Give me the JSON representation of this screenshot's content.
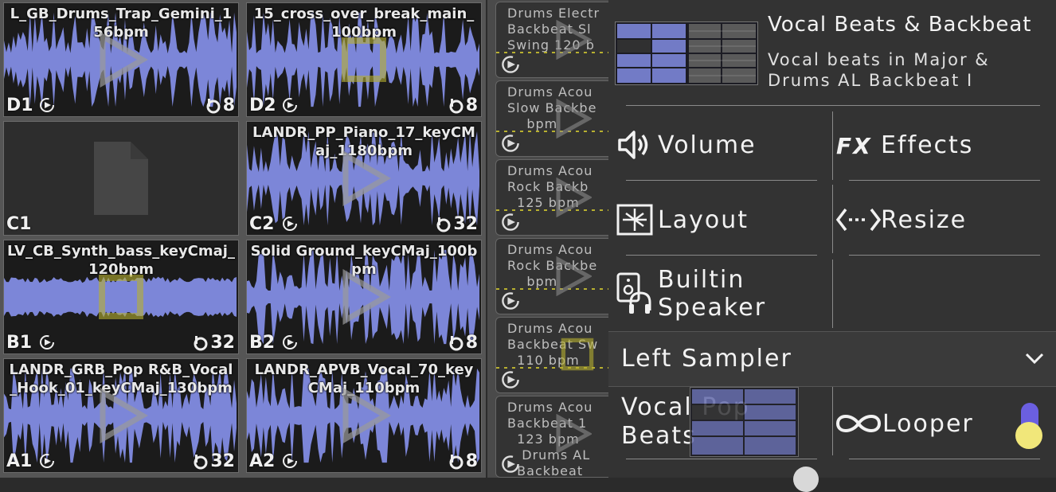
{
  "pads": [
    {
      "key": "D1",
      "title": "L_GB_Drums_Trap_Gemini_156bpm",
      "beats": "8",
      "state": "play"
    },
    {
      "key": "D2",
      "title": "15_cross_over_break_main_100bpm",
      "beats": "8",
      "state": "stop"
    },
    {
      "key": "C1",
      "title": "",
      "beats": "",
      "state": "empty"
    },
    {
      "key": "C2",
      "title": "LANDR_PP_Piano_17_keyCMaj_1180bpm",
      "beats": "32",
      "state": "play"
    },
    {
      "key": "B1",
      "title": "LV_CB_Synth_bass_keyCmaj_120bpm",
      "beats": "32",
      "state": "stop"
    },
    {
      "key": "B2",
      "title": "Solid Ground_keyCMaj_100bpm",
      "beats": "8",
      "state": "play"
    },
    {
      "key": "A1",
      "title": "LANDR_GRB_Pop R&B_Vocal_Hook_01_keyCMaj_130bpm",
      "beats": "32",
      "state": "play"
    },
    {
      "key": "A2",
      "title": "LANDR_APVB_Vocal_70_keyCMaj_110bpm",
      "beats": "8",
      "state": "play"
    }
  ],
  "strip": [
    {
      "text": "Drums Electr\nBackbeat Sl\nSwing 120 b",
      "state": "play"
    },
    {
      "text": "Drums Acou\nSlow Backbe\n    bpm",
      "state": "play"
    },
    {
      "text": "Drums Acou\nRock Backb\n  125 bpm",
      "state": "play"
    },
    {
      "text": "Drums Acou\nRock Backbe\n    bpm",
      "state": "play"
    },
    {
      "text": "Drums Acou\nBackbeat Sw\n  110 bpm",
      "state": "stop"
    },
    {
      "text": "Drums Acou\nBackbeat 1\n  123 bpm\n   Drums AL\n  Backbeat",
      "state": "play"
    }
  ],
  "panel": {
    "title": "Vocal Beats & Backbeat",
    "subtitle": "Vocal beats in Major &\nDrums AL Backbeat I",
    "volume": "Volume",
    "effects": "Effects",
    "layout": "Layout",
    "resize": "Resize",
    "speaker": "Builtin\nSpeaker",
    "sampler": "Left Sampler",
    "preset": "Vocal Pop\nBeats",
    "looper": "Looper"
  },
  "colors": {
    "wave": "#7c86d8",
    "accent": "#b8b030",
    "slider": "#f1e77a",
    "sliderTrack": "#6b5fe0"
  }
}
